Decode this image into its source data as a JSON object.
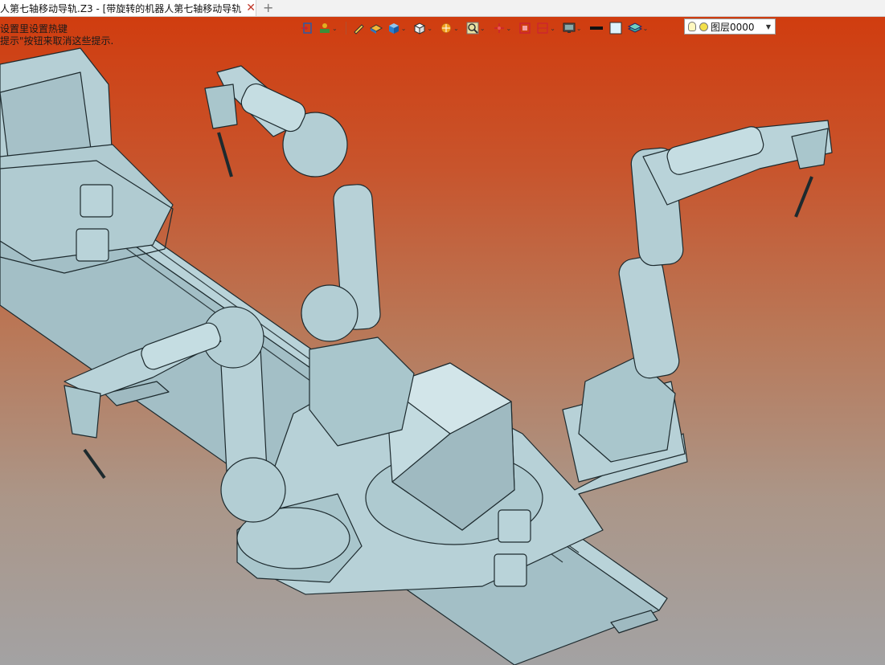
{
  "tab": {
    "title": "人第七轴移动导轨.Z3 - [带旋转的机器人第七轴移动导轨]",
    "close_glyph": "✕",
    "add_glyph": "+"
  },
  "hints": {
    "line1": "设置里设置热键",
    "line2": "提示\"按钮来取消这些提示."
  },
  "toolbar": {
    "icons": [
      "import-icon",
      "stamp-icon",
      "pen-icon",
      "part-icon",
      "box-shade-icon",
      "cube-icon",
      "render-icon",
      "zoom-icon",
      "pick-icon",
      "view-icon",
      "frame-icon",
      "monitor-icon",
      "line-color-icon",
      "fill-color-icon",
      "layer-stack-icon"
    ]
  },
  "layer": {
    "label": "图层0000",
    "dropdown_glyph": "▼"
  },
  "colors": {
    "background_top": "#d13a0c",
    "background_bottom": "#a3a2a3",
    "model": "#a9c6cc"
  }
}
